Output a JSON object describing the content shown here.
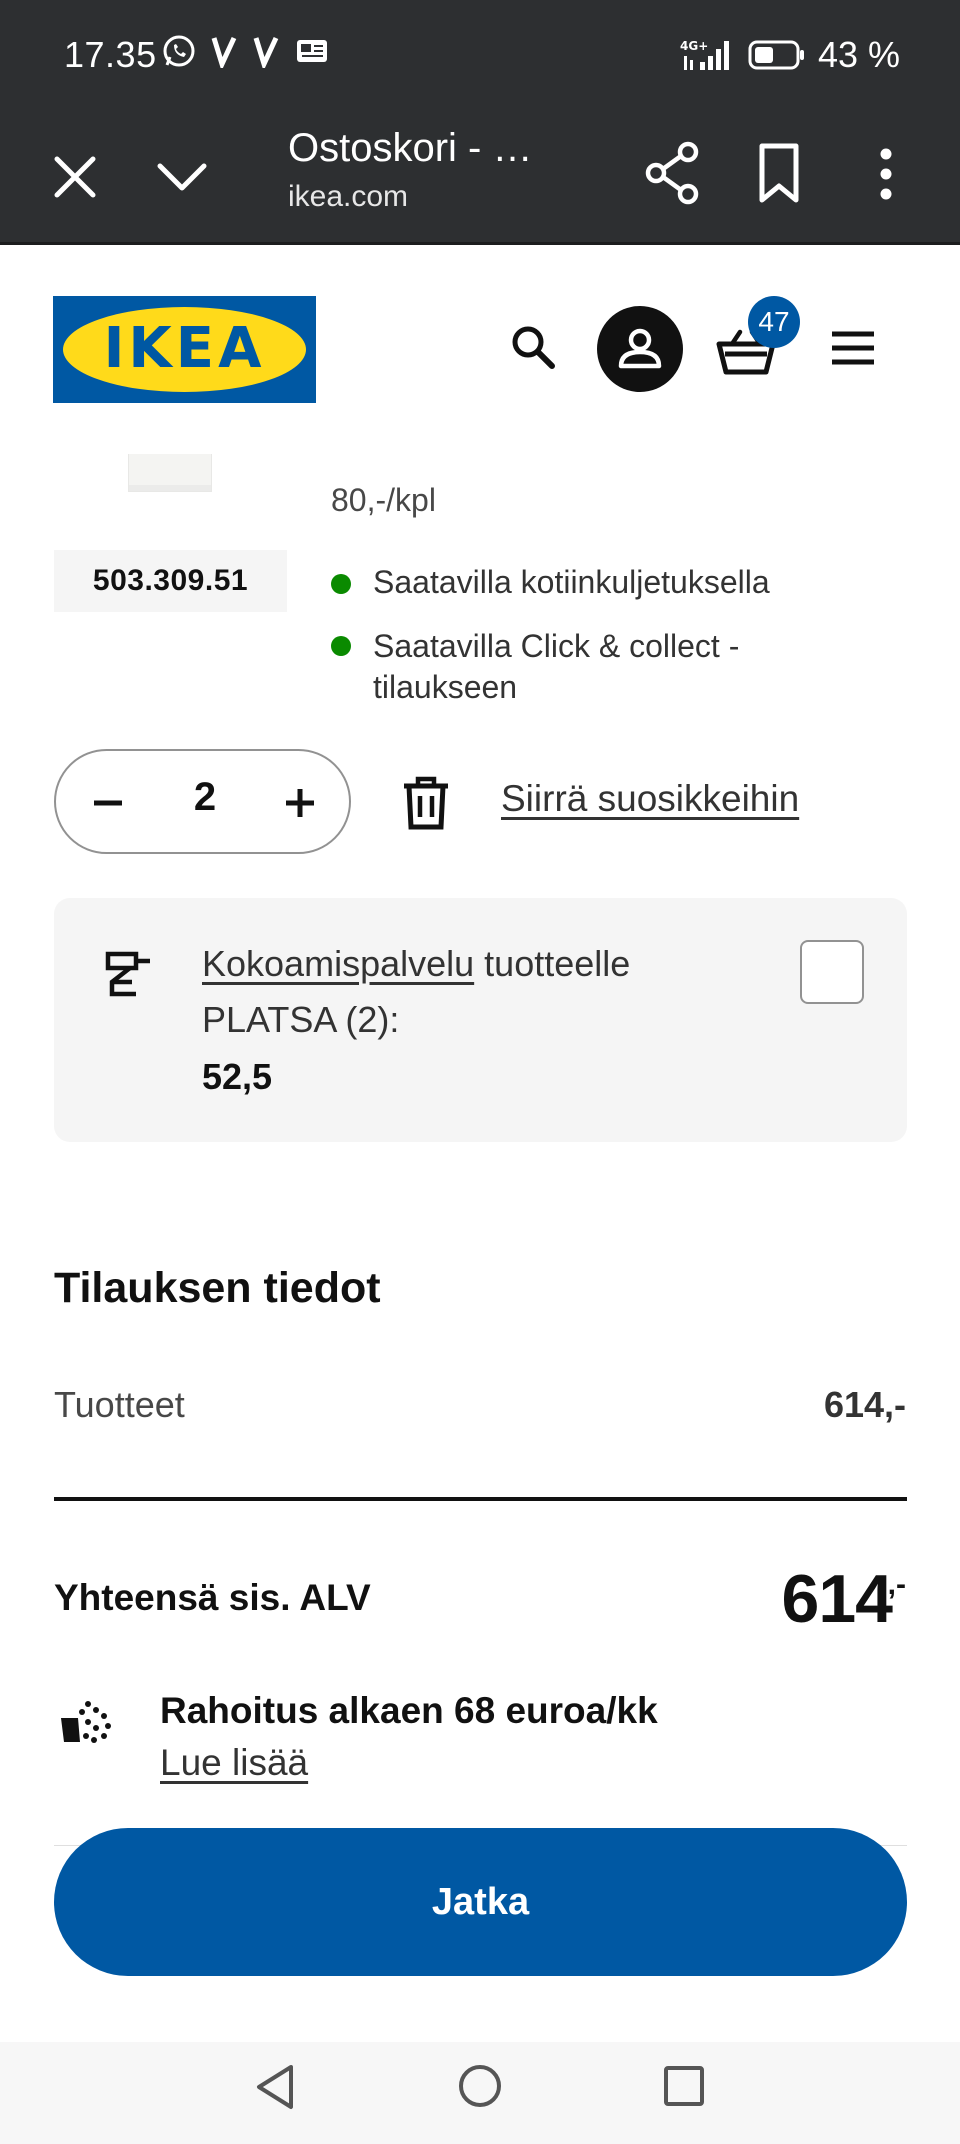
{
  "status_bar": {
    "time": "17.35",
    "network": "4G+",
    "battery": "43 %"
  },
  "browser": {
    "title": "Ostoskori - …",
    "url": "ikea.com"
  },
  "header": {
    "logo_text": "IKEA",
    "cart_count": "47"
  },
  "product": {
    "price_per_unit": "80,-/kpl",
    "article_number": "503.309.51",
    "availability": [
      "Saatavilla kotiinkuljetuksella",
      "Saatavilla Click & collect -tilaukseen"
    ],
    "quantity": "2",
    "move_to_favourites": "Siirrä suosikkeihin",
    "assembly": {
      "link": "Kokoamispalvelu",
      "text": "tuotteelle PLATSA (2):",
      "price": "52,5"
    }
  },
  "order": {
    "title": "Tilauksen tiedot",
    "products_label": "Tuotteet",
    "products_value": "614,-",
    "total_label": "Yhteensä sis. ALV",
    "total_value": "614",
    "total_suffix": ",-",
    "financing_title": "Rahoitus alkaen 68 euroa/kk",
    "financing_link": "Lue lisää",
    "continue_label": "Jatka"
  },
  "colors": {
    "ikea_blue": "#0058a3",
    "ikea_yellow": "#ffda1a",
    "available_green": "#0a8a00",
    "browser_bar": "#2d2f31"
  }
}
